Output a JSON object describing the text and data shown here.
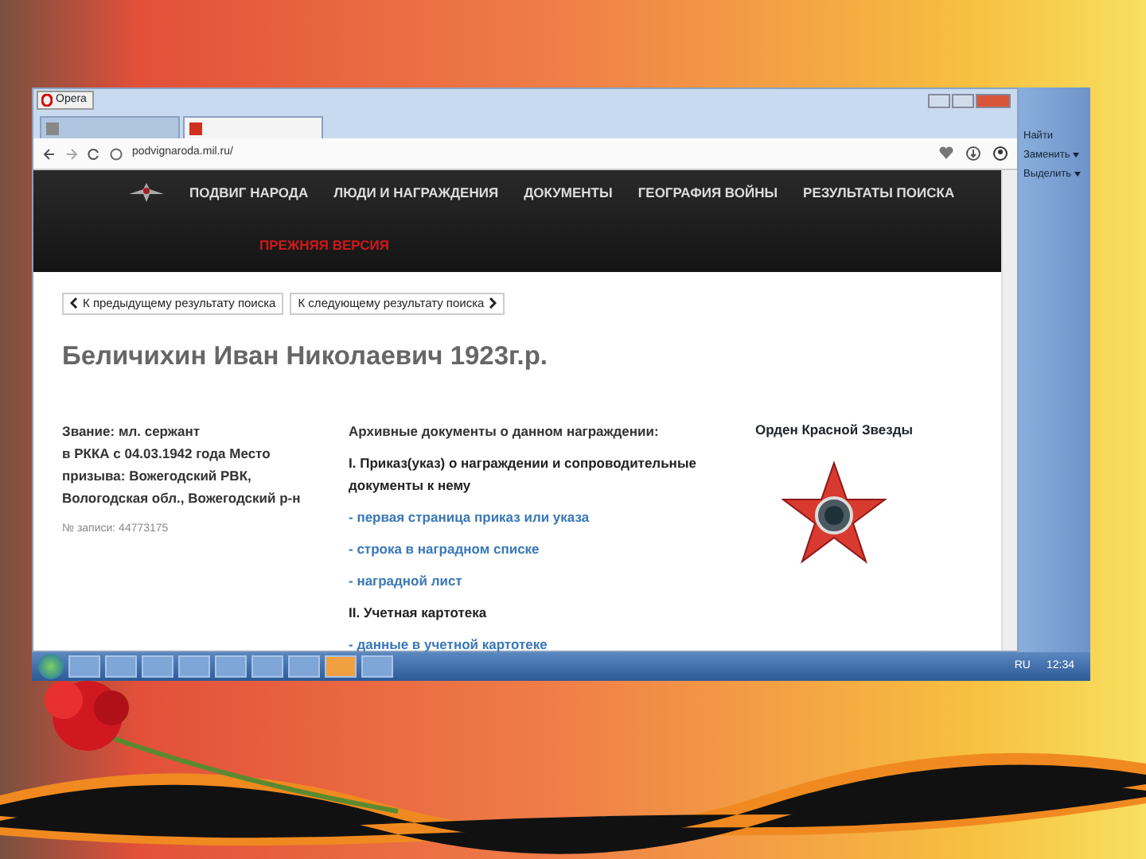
{
  "browser": {
    "menu_button": "Opera",
    "address": "podvignaroda.mil.ru/"
  },
  "tabs": [
    {
      "selected": false
    },
    {
      "selected": true
    }
  ],
  "site_nav": {
    "items": [
      "ПОДВИГ НАРОДА",
      "ЛЮДИ И НАГРАЖДЕНИЯ",
      "ДОКУМЕНТЫ",
      "ГЕОГРАФИЯ ВОЙНЫ",
      "РЕЗУЛЬТАТЫ ПОИСКА"
    ],
    "old_version_link": "ПРЕЖНЯЯ ВЕРСИЯ"
  },
  "pager": {
    "previous": "К предыдущему результату поиска",
    "next": "К следующему результату поиска"
  },
  "person": {
    "title": "Беличихин Иван Николаевич 1923г.р.",
    "details": [
      "Звание: мл. сержант",
      "в РККА с 04.03.1942 года Место призыва: Вожегодский РВК, Вологодская обл., Вожегодский р-н"
    ],
    "record_number": "№ записи: 44773175"
  },
  "documents": {
    "heading": "Архивные документы о данном награждении:",
    "sections": [
      {
        "title": "I. Приказ(указ) о награждении и сопроводительные документы к нему",
        "links": [
          "- первая страница приказ или указа",
          "- строка в наградном списке",
          "- наградной лист"
        ]
      },
      {
        "title": "II. Учетная картотека",
        "links": [
          "- данные в учетной картотеке"
        ]
      }
    ]
  },
  "award": {
    "name": "Орден Красной Звезды"
  },
  "word_panel": {
    "items": [
      "Найти",
      "Заменить",
      "Выделить"
    ]
  },
  "taskbar": {
    "language": "RU",
    "clock": "12:34"
  }
}
